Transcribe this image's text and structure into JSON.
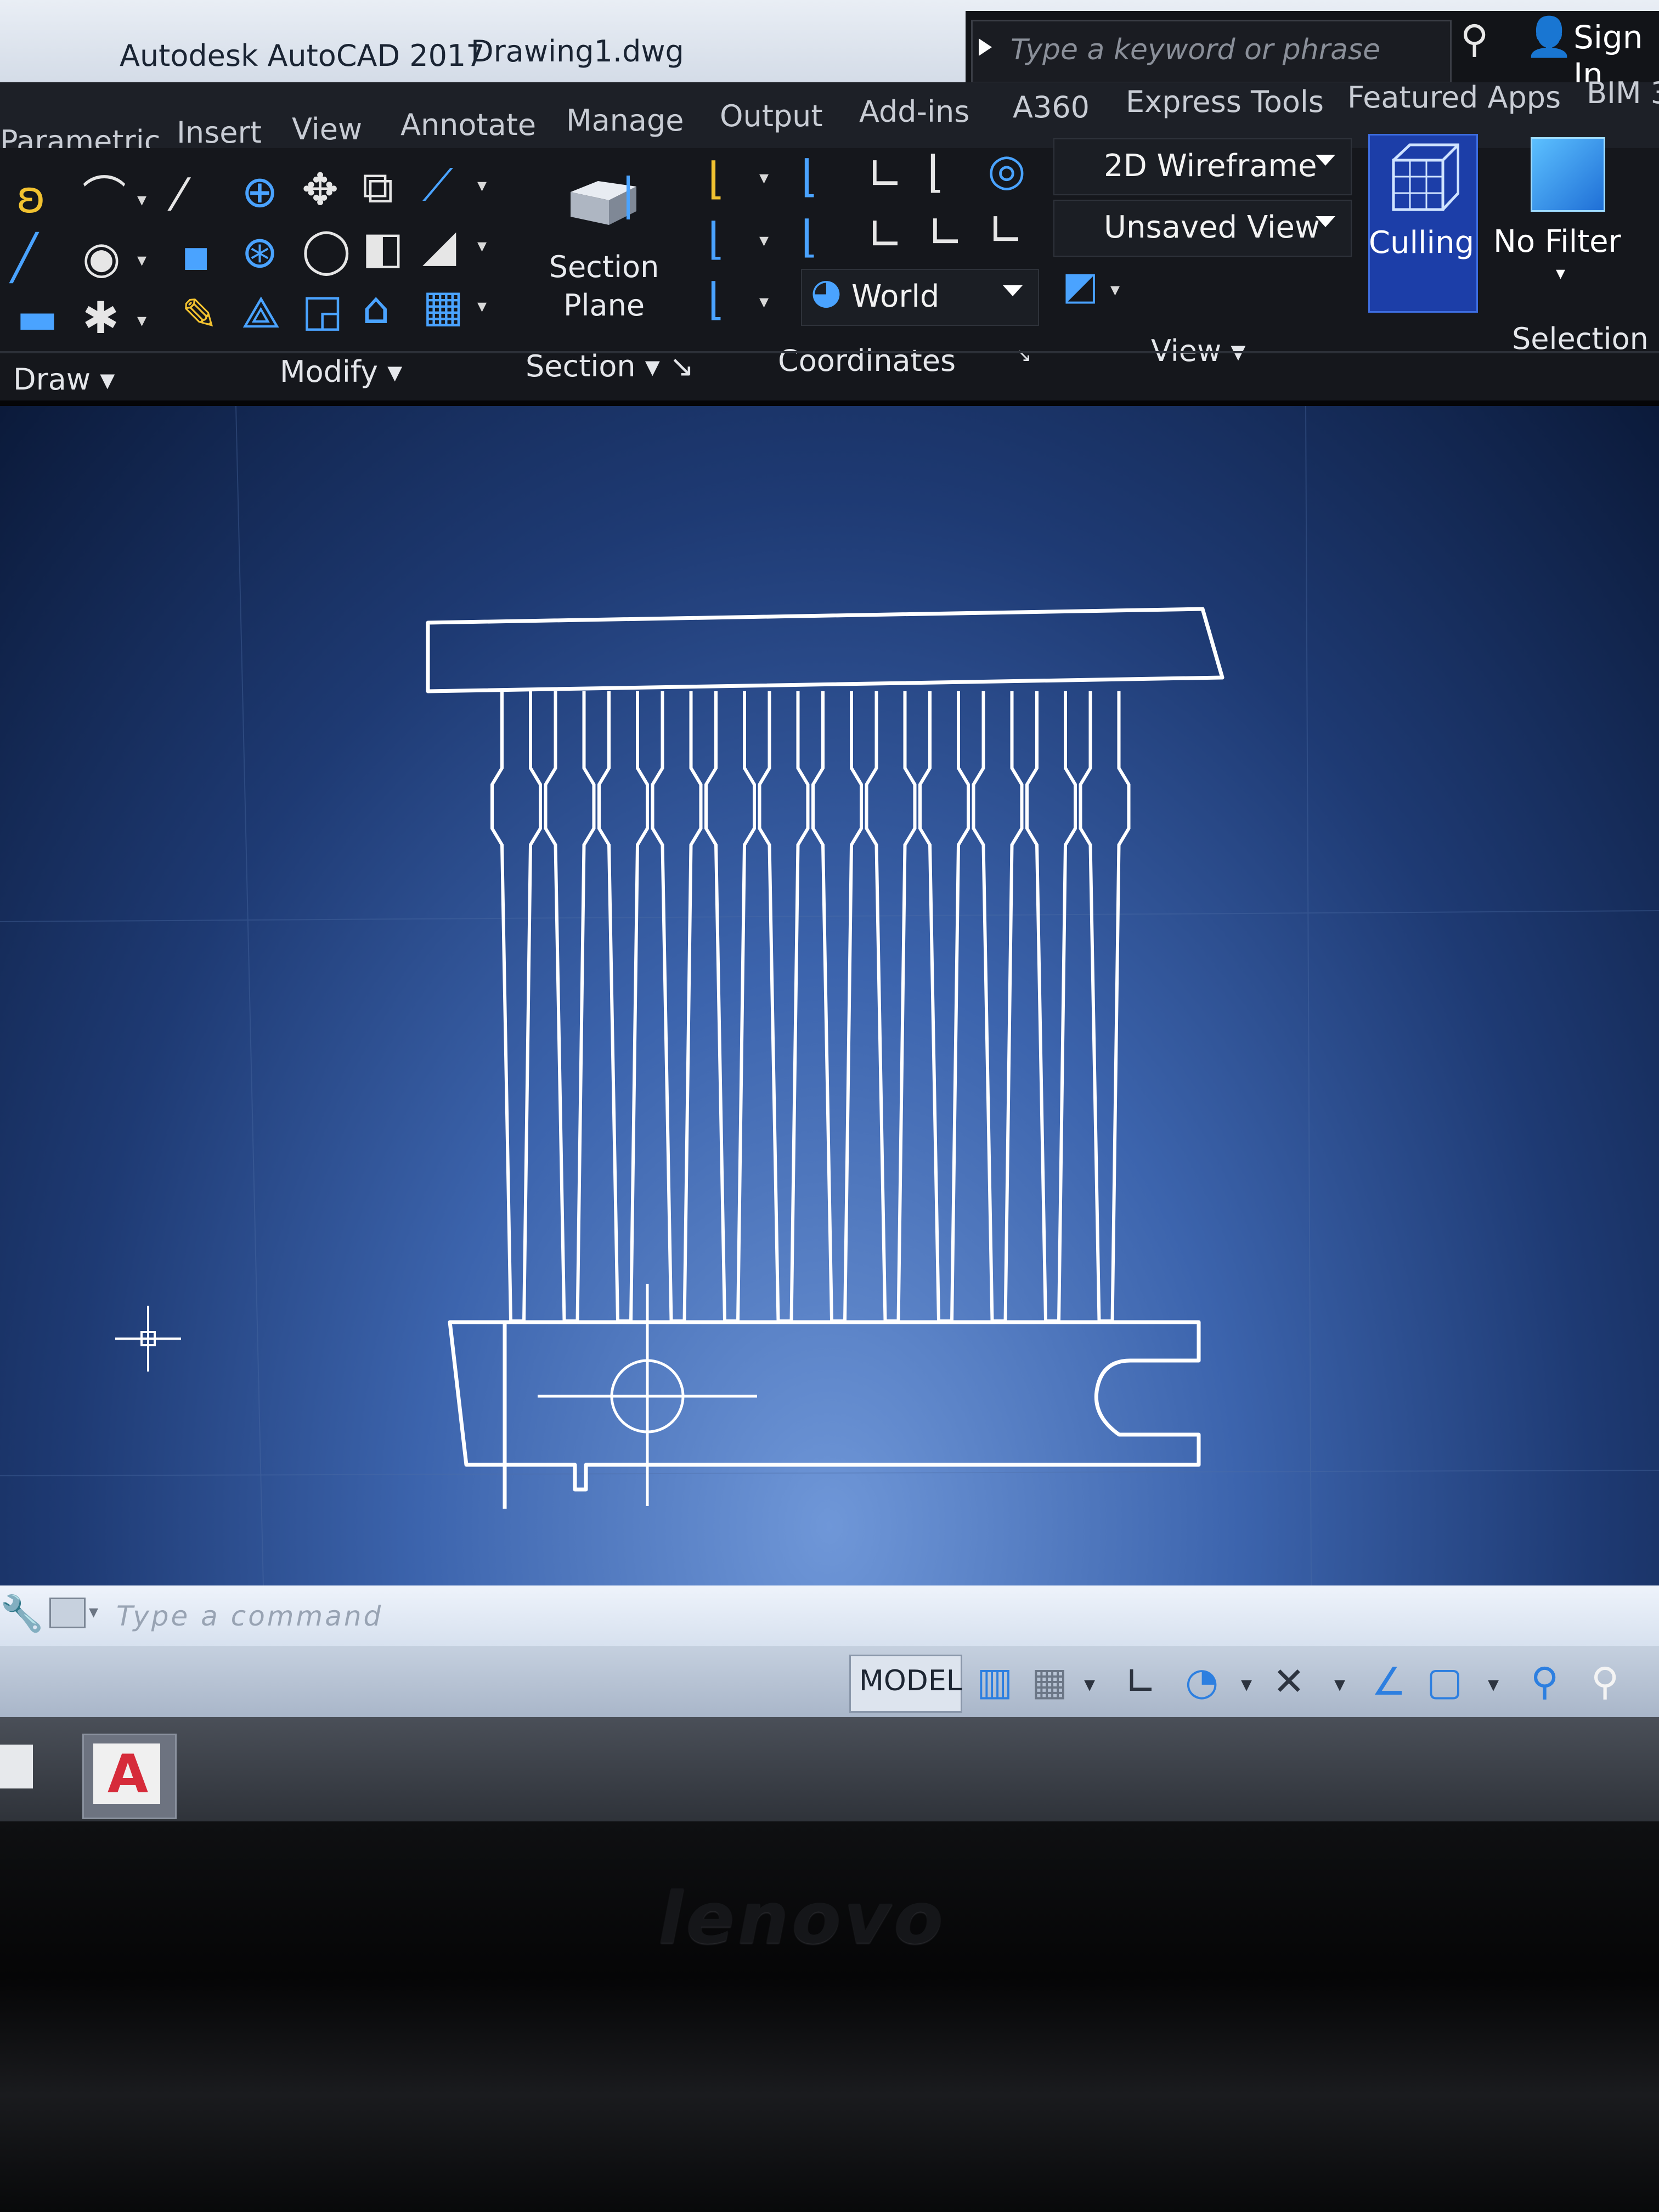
{
  "titlebar": {
    "app_title": "Autodesk AutoCAD 2017",
    "file_name": "Drawing1.dwg",
    "search_placeholder": "Type a keyword or phrase",
    "sign_in": "Sign In"
  },
  "tabs": [
    "Parametric",
    "Insert",
    "View",
    "Annotate",
    "Manage",
    "Output",
    "Add-ins",
    "A360",
    "Express Tools",
    "Featured Apps",
    "BIM 3"
  ],
  "ribbon": {
    "panels": {
      "draw": "Draw",
      "modify": "Modify",
      "section": "Section",
      "coordinates": "Coordinates",
      "view": "View",
      "selection": "Selection"
    },
    "section_plane": "Section Plane",
    "visual_style": "2D Wireframe",
    "named_view": "Unsaved View",
    "ucs": "World",
    "culling": "Culling",
    "no_filter": "No Filter"
  },
  "command_line": {
    "placeholder": "Type a command"
  },
  "status_bar": {
    "model": "MODEL"
  },
  "bezel": {
    "brand": "lenovo"
  },
  "colors": {
    "ribbon_bg": "#15171c",
    "accent_blue": "#1c3ea8",
    "drawing_line": "#ffffff",
    "canvas_blue": "#3c64ad"
  }
}
